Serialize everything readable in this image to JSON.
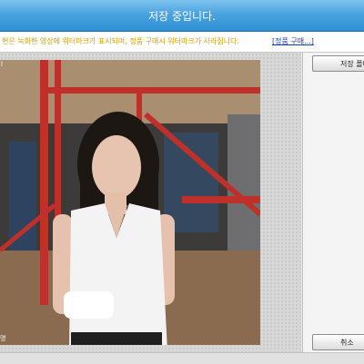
{
  "window": {
    "title": "저장 중입니다."
  },
  "notice": {
    "message": "현은 녹화한 영상에 워터마크가 표시되며, 정품 구매시 워터마크가 사라집니다.",
    "link": "[정품 구매...]"
  },
  "preview": {
    "corner_label": "l",
    "bottom_label": "명"
  },
  "buttons": {
    "top_label": "저장 폴더",
    "bottom_label": "취소"
  }
}
